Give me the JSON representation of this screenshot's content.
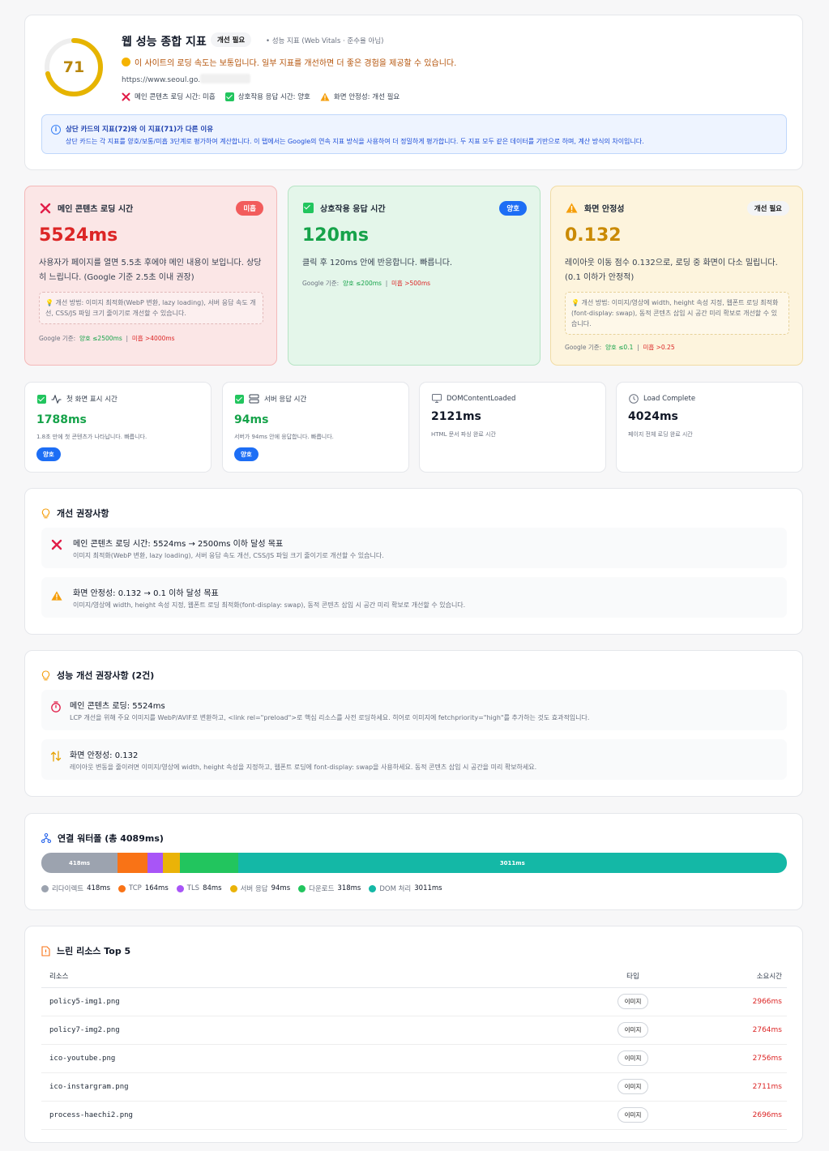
{
  "summary": {
    "score": "71",
    "title": "웹 성능 종합 지표",
    "badge": "개선 필요",
    "note": "• 성능 지표 (Web Vitals · 준수율 아님)",
    "message": "이 사이트의 로딩 속도는 보통입니다. 일부 지표를 개선하면 더 좋은 경험을 제공할 수 있습니다.",
    "url": "https://www.seoul.go.",
    "status": [
      {
        "icon": "x-icon",
        "text": "메인 콘텐츠 로딩 시간: 미흡"
      },
      {
        "icon": "check-icon",
        "text": "상호작용 응답 시간: 양호"
      },
      {
        "icon": "warning-icon",
        "text": "화면 안정성: 개선 필요"
      }
    ],
    "info_title": "상단 카드의 지표(72)와 이 지표(71)가 다른 이유",
    "info_text": "상단 카드는 각 지표를 양호/보통/미흡 3단계로 평가하여 계산합니다. 이 탭에서는 Google의 연속 지표 방식을 사용하여 더 정밀하게 평가합니다. 두 지표 모두 같은 데이터를 기반으로 하며, 계산 방식의 차이입니다.",
    "colors": {
      "gauge": "#e6b400",
      "gauge_track": "#eeeeee"
    }
  },
  "metrics": {
    "lcp": {
      "title": "메인 콘텐츠 로딩 시간",
      "badge": "미흡",
      "value": "5524ms",
      "desc": "사용자가 페이지를 열면 5.5초 후에야 메인 내용이 보입니다. 상당히 느립니다. (Google 기준 2.5초 이내 권장)",
      "tip": "개선 방법: 이미지 최적화(WebP 변환, lazy loading), 서버 응답 속도 개선, CSS/JS 파일 크기 줄이기로 개선할 수 있습니다.",
      "std_label": "Google 기준:",
      "std_good": "양호 ≤2500ms",
      "std_bad": "미흡 >4000ms",
      "color": "#dc2626"
    },
    "inp": {
      "title": "상호작용 응답 시간",
      "badge": "양호",
      "value": "120ms",
      "desc": "클릭 후 120ms 안에 반응합니다. 빠릅니다.",
      "std_label": "Google 기준:",
      "std_good": "양호 ≤200ms",
      "std_bad": "미흡 >500ms",
      "color": "#16a34a"
    },
    "cls": {
      "title": "화면 안정성",
      "badge": "개선 필요",
      "value": "0.132",
      "desc": "레이아웃 이동 점수 0.132으로, 로딩 중 화면이 다소 밀립니다. (0.1 이하가 안정적)",
      "tip": "개선 방법: 이미지/영상에 width, height 속성 지정, 웹폰트 로딩 최적화(font-display: swap), 동적 콘텐츠 삽입 시 공간 미리 확보로 개선할 수 있습니다.",
      "std_label": "Google 기준:",
      "std_good": "양호 ≤0.1",
      "std_bad": "미흡 >0.25",
      "color": "#ca8a04"
    }
  },
  "small_cards": [
    {
      "title": "첫 화면 표시 시간",
      "value": "1788ms",
      "desc": "1.8초 만에 첫 콘텐츠가 나타납니다. 빠릅니다.",
      "badge": "양호"
    },
    {
      "title": "서버 응답 시간",
      "value": "94ms",
      "desc": "서버가 94ms 안에 응답합니다. 빠릅니다.",
      "badge": "양호"
    },
    {
      "title": "DOMContentLoaded",
      "value": "2121ms",
      "desc": "HTML 문서 파싱 완료 시간"
    },
    {
      "title": "Load Complete",
      "value": "4024ms",
      "desc": "페이지 전체 로딩 완료 시간"
    }
  ],
  "recommendations": {
    "title": "개선 권장사항",
    "items": [
      {
        "title": "메인 콘텐츠 로딩 시간: 5524ms → 2500ms 이하 달성 목표",
        "text": "이미지 최적화(WebP 변환, lazy loading), 서버 응답 속도 개선, CSS/JS 파일 크기 줄이기로 개선할 수 있습니다."
      },
      {
        "title": "화면 안정성: 0.132 → 0.1 이하 달성 목표",
        "text": "이미지/영상에 width, height 속성 지정, 웹폰트 로딩 최적화(font-display: swap), 동적 콘텐츠 삽입 시 공간 미리 확보로 개선할 수 있습니다."
      }
    ]
  },
  "perf_recommendations": {
    "title": "성능 개선 권장사항 (2건)",
    "items": [
      {
        "title": "메인 콘텐츠 로딩: 5524ms",
        "text": "LCP 개선을 위해 주요 이미지를 WebP/AVIF로 변환하고, <link rel=\"preload\">로 핵심 리소스를 사전 로딩하세요. 히어로 이미지에 fetchpriority=\"high\"를 추가하는 것도 효과적입니다."
      },
      {
        "title": "화면 안정성: 0.132",
        "text": "레이아웃 변동을 줄이려면 이미지/영상에 width, height 속성을 지정하고, 웹폰트 로딩에 font-display: swap을 사용하세요. 동적 콘텐츠 삽입 시 공간을 미리 확보하세요."
      }
    ]
  },
  "waterfall": {
    "title": "연결 워터폴 (총 4089ms)",
    "segments": [
      {
        "name": "리다이렉트",
        "ms": 418,
        "value": "418ms",
        "label": "418ms",
        "color": "#9ca3af"
      },
      {
        "name": "TCP",
        "ms": 164,
        "value": "164ms",
        "label": "",
        "color": "#f97316"
      },
      {
        "name": "TLS",
        "ms": 84,
        "value": "84ms",
        "label": "",
        "color": "#a855f7"
      },
      {
        "name": "서버 응답",
        "ms": 94,
        "value": "94ms",
        "label": "",
        "color": "#eab308"
      },
      {
        "name": "다운로드",
        "ms": 318,
        "value": "318ms",
        "label": "",
        "color": "#22c55e"
      },
      {
        "name": "DOM 처리",
        "ms": 3011,
        "value": "3011ms",
        "label": "3011ms",
        "color": "#14b8a6"
      }
    ]
  },
  "slow_resources": {
    "title": "느린 리소스 Top 5",
    "headers": {
      "name": "리소스",
      "type": "타입",
      "time": "소요시간"
    },
    "rows": [
      {
        "name": "policy5-img1.png",
        "type": "이미지",
        "time": "2966ms"
      },
      {
        "name": "policy7-img2.png",
        "type": "이미지",
        "time": "2764ms"
      },
      {
        "name": "ico-youtube.png",
        "type": "이미지",
        "time": "2756ms"
      },
      {
        "name": "ico-instargram.png",
        "type": "이미지",
        "time": "2711ms"
      },
      {
        "name": "process-haechi2.png",
        "type": "이미지",
        "time": "2696ms"
      }
    ]
  }
}
